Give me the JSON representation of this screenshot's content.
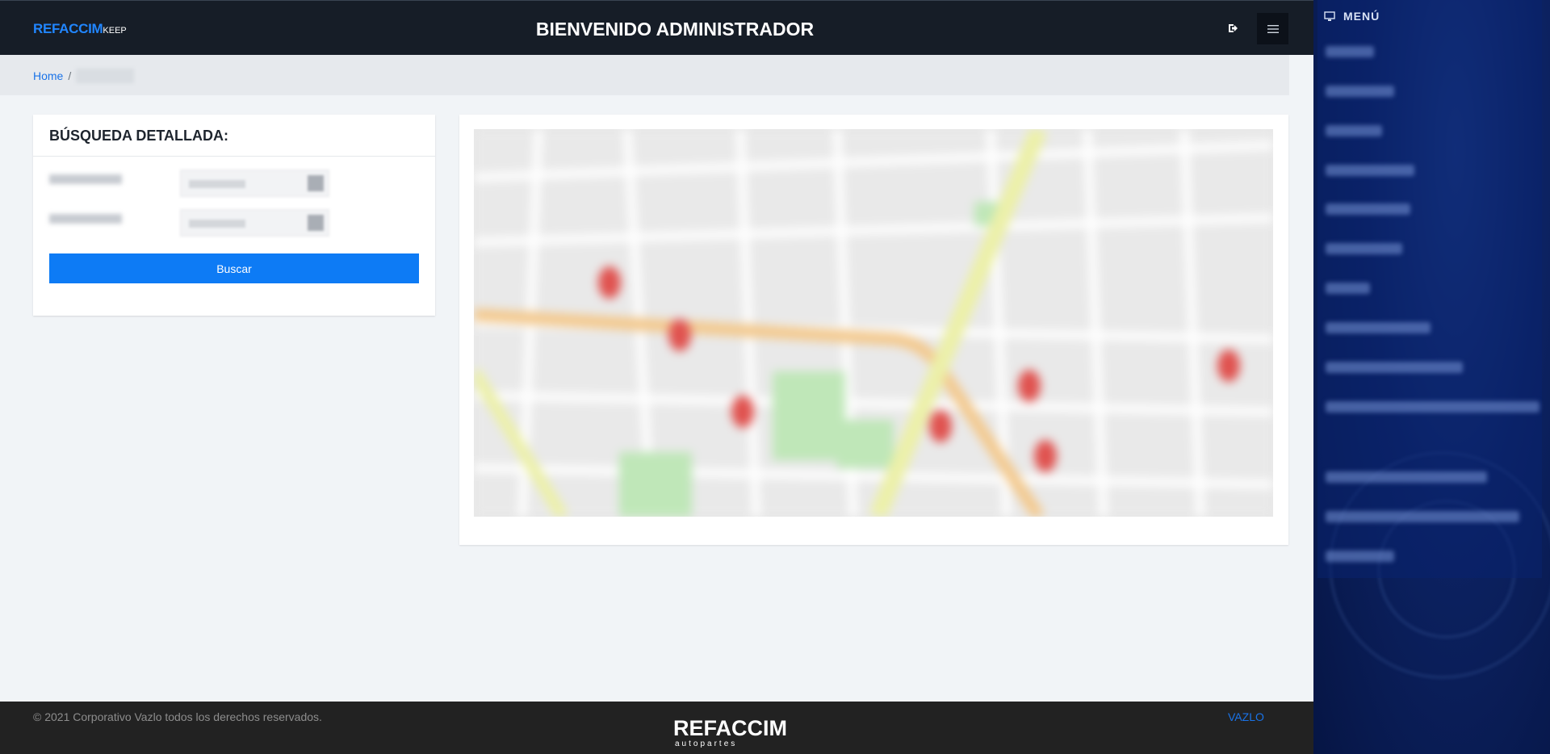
{
  "header": {
    "brand_main": "REFACCIM",
    "brand_sub": "KEEP",
    "title": "BIENVENIDO ADMINISTRADOR",
    "logout_icon": "logout-icon",
    "menu_icon": "hamburger-icon"
  },
  "breadcrumb": {
    "home": "Home",
    "separator": "/"
  },
  "search": {
    "title": "BÚSQUEDA DETALLADA:",
    "button_label": "Buscar"
  },
  "map": {
    "markers": 8
  },
  "sidebar": {
    "icon": "monitor-icon",
    "title": "MENÚ"
  },
  "footer": {
    "copyright": "© 2021 Corporativo Vazlo todos los derechos reservados.",
    "logo_text": "REFACCIM",
    "logo_sub": "autopartes",
    "link": "VAZLO"
  },
  "colors": {
    "topbar": "#161d27",
    "accent_blue": "#0d7bf5",
    "footer": "#222222",
    "sidebar": "#0c2262",
    "marker": "#e0524f"
  }
}
